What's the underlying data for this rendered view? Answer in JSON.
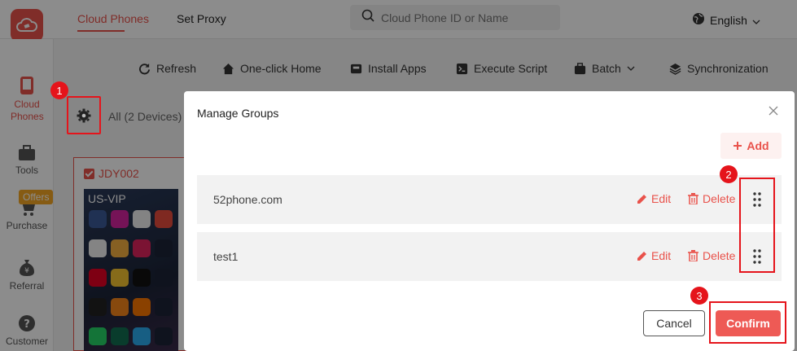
{
  "topbar": {
    "tabs": [
      {
        "label": "Cloud Phones",
        "active": true
      },
      {
        "label": "Set Proxy",
        "active": false
      }
    ],
    "search_placeholder": "Cloud Phone ID or Name",
    "language": "English"
  },
  "sidebar": {
    "items": [
      {
        "label": "Cloud Phones",
        "icon": "phone-icon",
        "active": true
      },
      {
        "label": "Tools",
        "icon": "toolbox-icon"
      },
      {
        "label": "Purchase",
        "icon": "cart-icon",
        "badge": "Offers"
      },
      {
        "label": "Referral",
        "icon": "money-bag-icon"
      },
      {
        "label": "Customer",
        "icon": "help-icon"
      }
    ]
  },
  "toolbar": {
    "items": [
      {
        "label": "Refresh",
        "icon": "refresh-icon"
      },
      {
        "label": "One-click Home",
        "icon": "home-icon"
      },
      {
        "label": "Install Apps",
        "icon": "install-icon"
      },
      {
        "label": "Execute Script",
        "icon": "script-icon"
      },
      {
        "label": "Batch",
        "icon": "batch-icon"
      },
      {
        "label": "Synchronization",
        "icon": "layers-icon"
      }
    ]
  },
  "devices": {
    "all_label": "All (2 Devices)",
    "card": {
      "name": "JDY002",
      "screen_label": "US-VIP"
    }
  },
  "annotations": {
    "step1": "1",
    "step2": "2",
    "step3": "3"
  },
  "modal": {
    "title": "Manage Groups",
    "add_label": "Add",
    "groups": [
      {
        "name": "52phone.com",
        "edit_label": "Edit",
        "delete_label": "Delete"
      },
      {
        "name": "test1",
        "edit_label": "Edit",
        "delete_label": "Delete"
      }
    ],
    "cancel_label": "Cancel",
    "confirm_label": "Confirm"
  },
  "colors": {
    "accent": "#e9524b",
    "annotation": "#e5141b",
    "confirm": "#ee5a55"
  }
}
